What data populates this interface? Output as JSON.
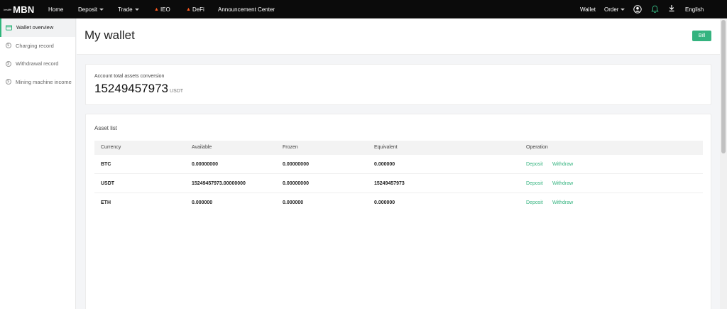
{
  "brand": {
    "small": "bestlife",
    "name": "MBN"
  },
  "nav": {
    "home": "Home",
    "deposit": "Deposit",
    "trade": "Trade",
    "ieo": "IEO",
    "defi": "DeFi",
    "announcement": "Announcement Center",
    "wallet": "Wallet",
    "order": "Order",
    "language": "English"
  },
  "sidebar": {
    "items": [
      {
        "label": "Wallet overview"
      },
      {
        "label": "Charging record"
      },
      {
        "label": "Withdrawal record"
      },
      {
        "label": "Mining machine income"
      }
    ]
  },
  "page": {
    "title": "My wallet",
    "bill_label": "Bill"
  },
  "assets": {
    "label": "Account total assets conversion",
    "value": "15249457973",
    "unit": "USDT"
  },
  "asset_list": {
    "title": "Asset list",
    "columns": [
      "Currency",
      "Available",
      "Frozen",
      "Equivalent",
      "Operation"
    ],
    "rows": [
      {
        "currency": "BTC",
        "available": "0.00000000",
        "frozen": "0.00000000",
        "equivalent": "0.000000",
        "deposit": "Deposit",
        "withdraw": "Withdraw"
      },
      {
        "currency": "USDT",
        "available": "15249457973.00000000",
        "frozen": "0.00000000",
        "equivalent": "15249457973",
        "deposit": "Deposit",
        "withdraw": "Withdraw"
      },
      {
        "currency": "ETH",
        "available": "0.000000",
        "frozen": "0.000000",
        "equivalent": "0.000000",
        "deposit": "Deposit",
        "withdraw": "Withdraw"
      }
    ]
  },
  "colors": {
    "accent": "#34b37f",
    "navbar": "#0b0b0b"
  },
  "icons": {
    "wallet": "wallet-icon",
    "coin": "coin-icon",
    "user": "user-icon",
    "bell": "bell-icon",
    "download": "download-icon"
  }
}
